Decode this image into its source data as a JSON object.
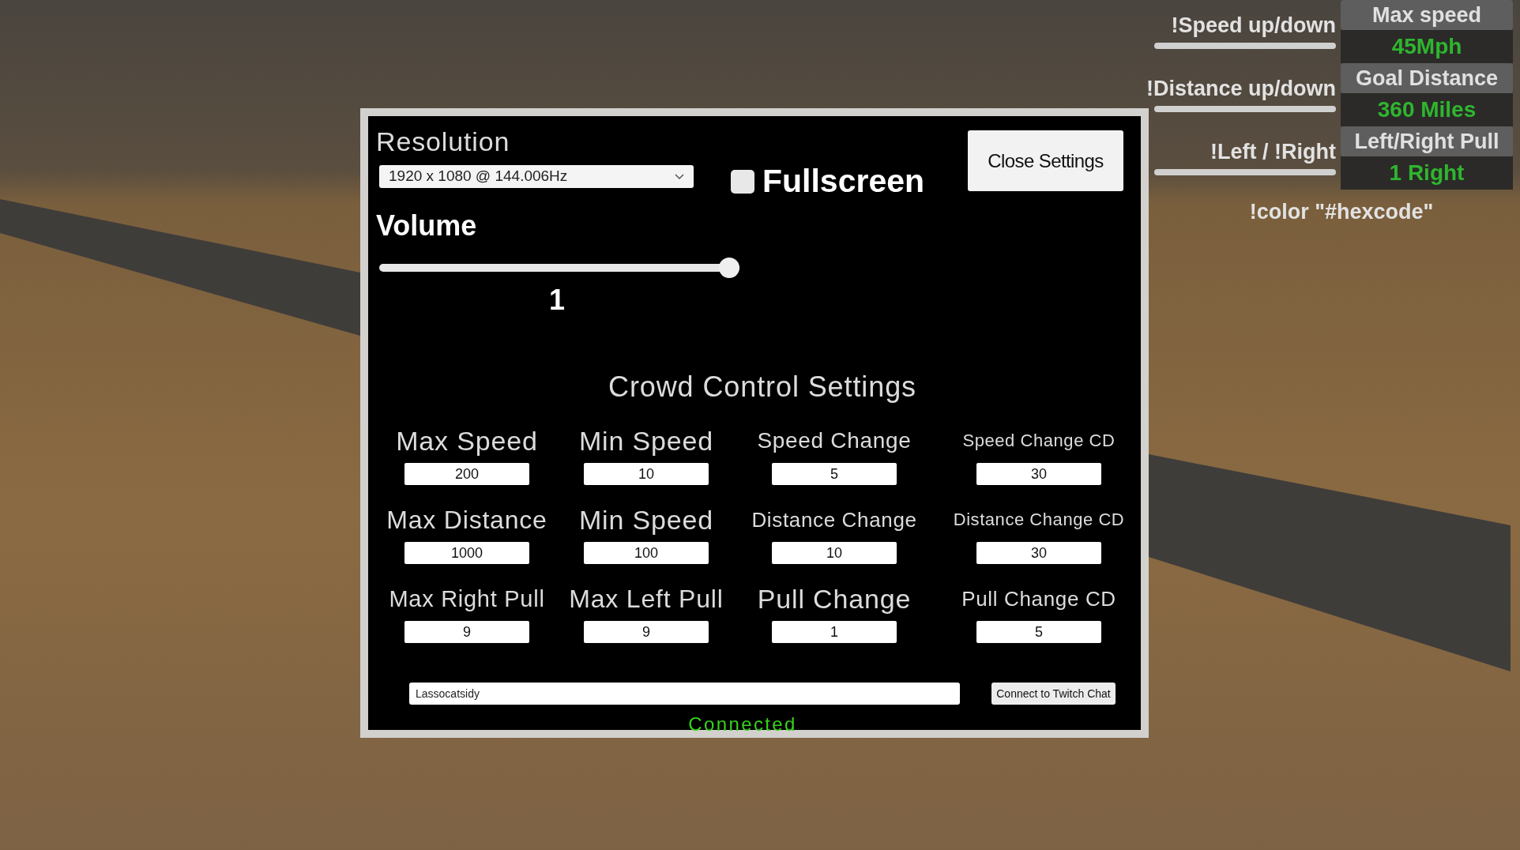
{
  "hud": {
    "commands": [
      "!Speed up/down",
      "!Distance up/down",
      "!Left / !Right"
    ],
    "stats": [
      {
        "label": "Max speed",
        "value": "45Mph"
      },
      {
        "label": "Goal Distance",
        "value": "360 Miles"
      },
      {
        "label": "Left/Right Pull",
        "value": "1 Right"
      }
    ],
    "color_hint": "!color \"#hexcode\""
  },
  "settings": {
    "resolution": {
      "label": "Resolution",
      "value": "1920 x 1080 @ 144.006Hz"
    },
    "fullscreen": {
      "label": "Fullscreen",
      "checked": false
    },
    "close_button": "Close Settings",
    "volume": {
      "label": "Volume",
      "level": 1,
      "reading": "1"
    },
    "crowd_control": {
      "title": "Crowd Control Settings",
      "fields": [
        {
          "label": "Max Speed",
          "value": "200"
        },
        {
          "label": "Min Speed",
          "value": "10"
        },
        {
          "label": "Speed Change",
          "value": "5"
        },
        {
          "label": "Speed Change CD",
          "value": "30"
        },
        {
          "label": "Max Distance",
          "value": "1000"
        },
        {
          "label": "Min Speed",
          "value": "100"
        },
        {
          "label": "Distance Change",
          "value": "10"
        },
        {
          "label": "Distance Change CD",
          "value": "30"
        },
        {
          "label": "Max Right Pull",
          "value": "9"
        },
        {
          "label": "Max Left Pull",
          "value": "9"
        },
        {
          "label": "Pull Change",
          "value": "1"
        },
        {
          "label": "Pull Change CD",
          "value": "5"
        }
      ]
    },
    "twitch": {
      "value": "Lassocatsidy",
      "button": "Connect to Twitch Chat",
      "status": "Connected"
    }
  }
}
